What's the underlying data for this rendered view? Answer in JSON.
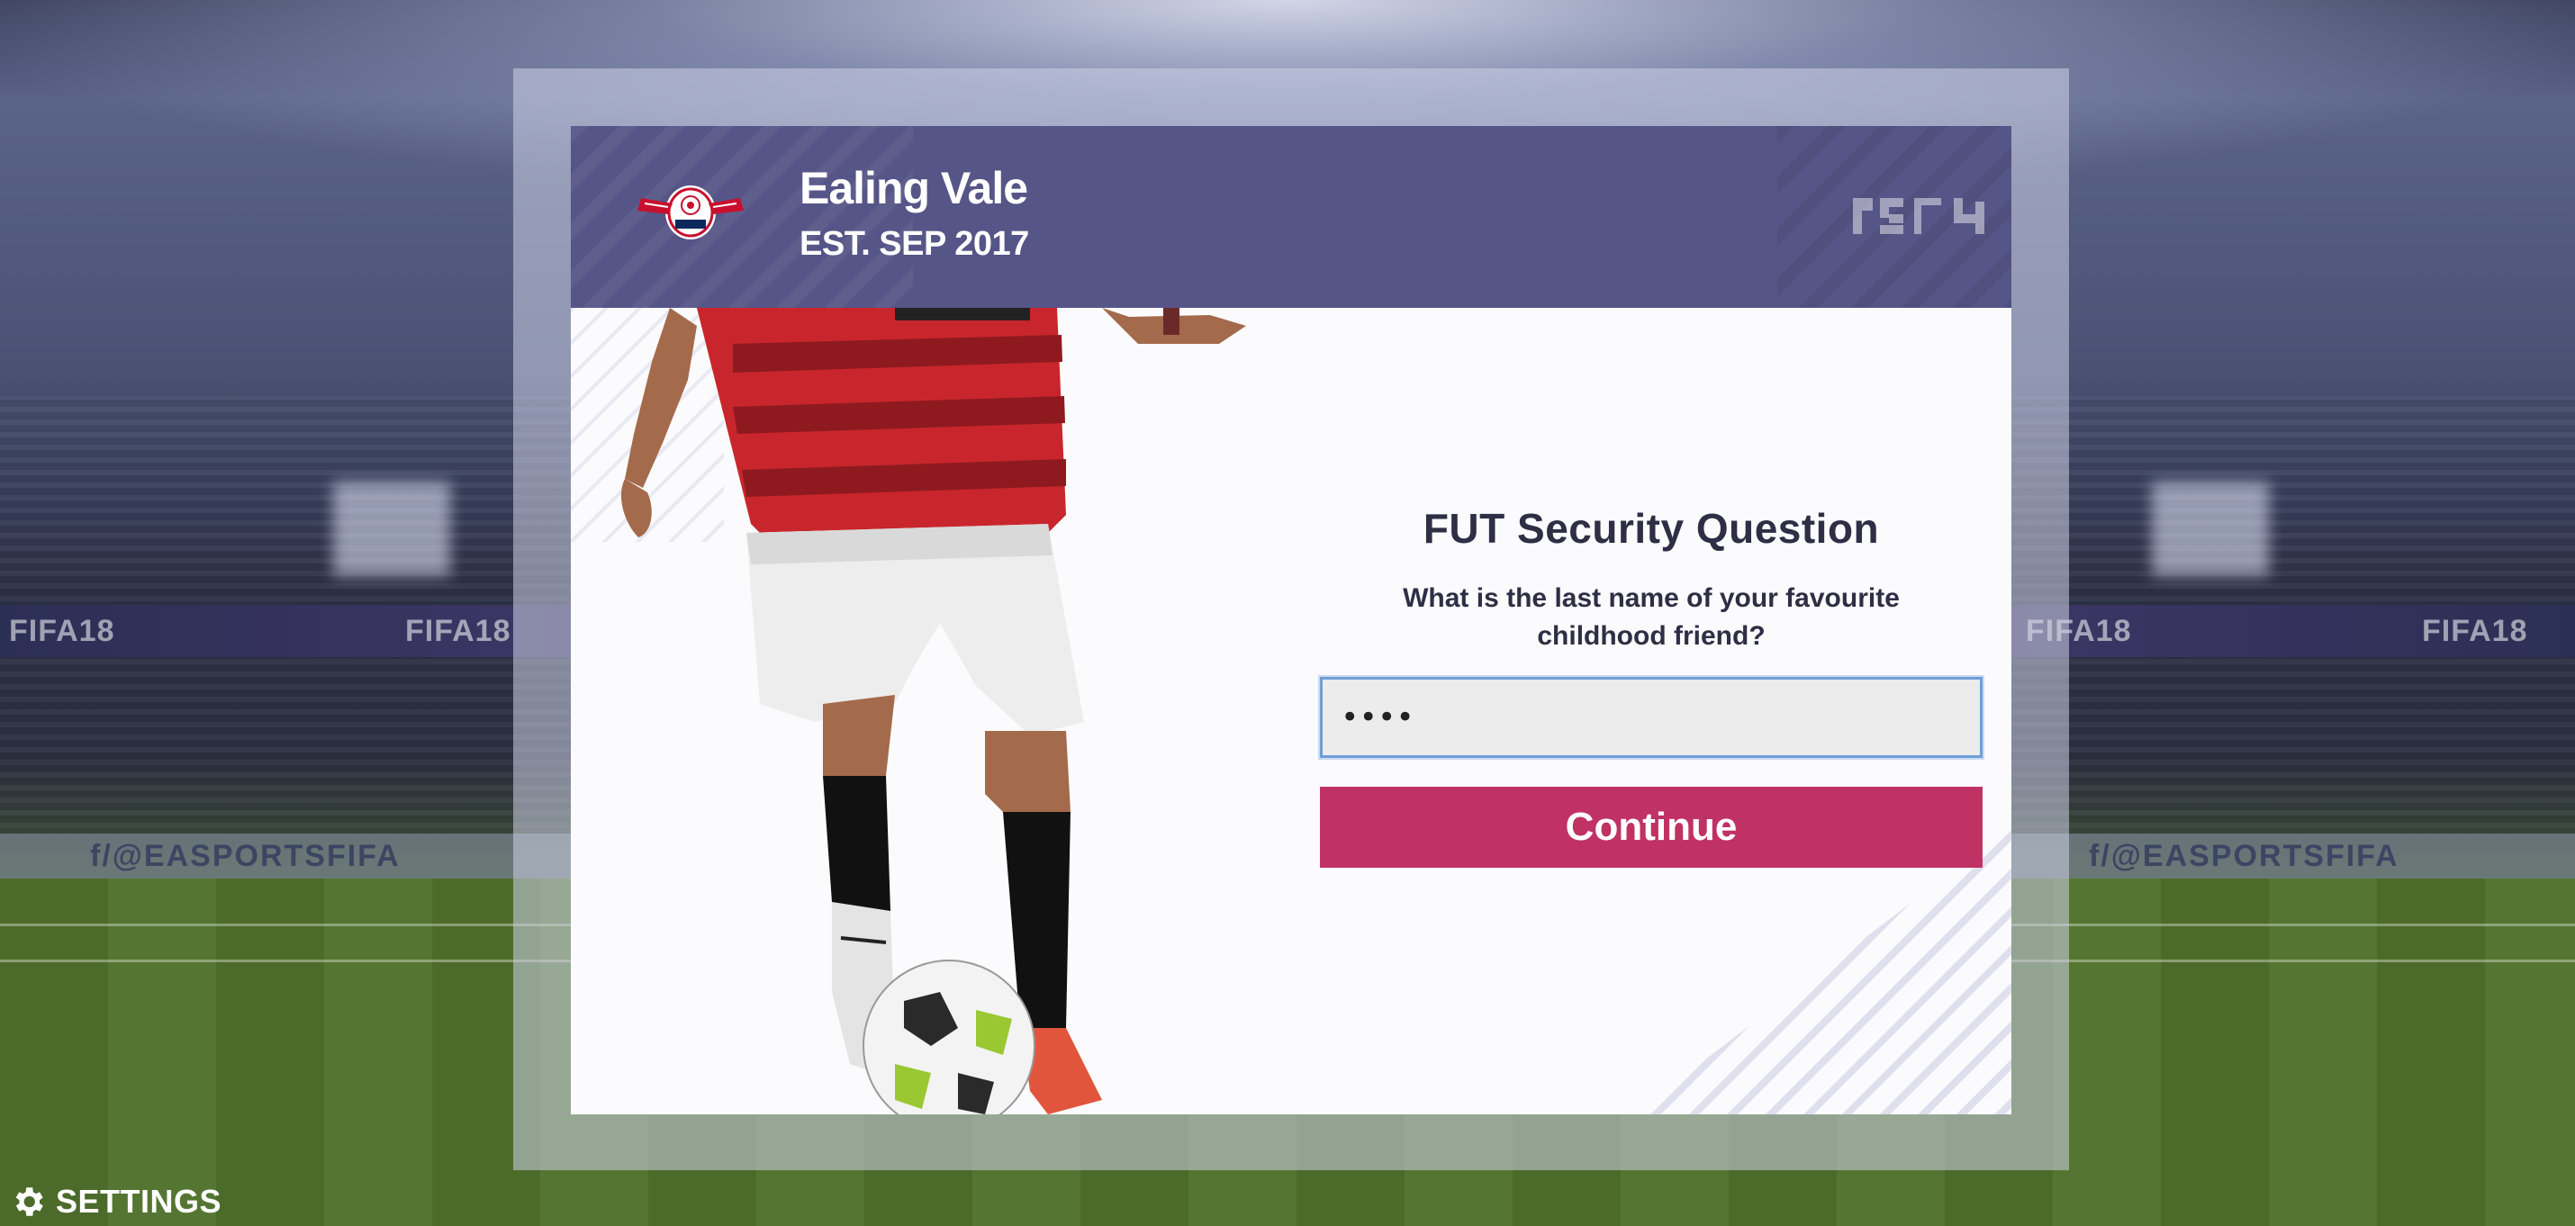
{
  "header": {
    "club_name": "Ealing Vale",
    "club_established": "EST. SEP 2017",
    "crest_icon": "club-crest-icon",
    "platform_logo": "ps4-logo"
  },
  "background": {
    "board_text": "FIFA18",
    "ad_text": "f/@EASPORTSFIFA"
  },
  "form": {
    "title": "FUT Security Question",
    "question": "What is the last name of your favourite childhood friend?",
    "answer_value": "••••",
    "continue_label": "Continue"
  },
  "footer": {
    "settings_label": "SETTINGS",
    "settings_icon": "gear-icon"
  },
  "colors": {
    "header": "#565587",
    "button": "#c03263",
    "input_border": "#6f9fd8",
    "title_text": "#2e2e45"
  }
}
